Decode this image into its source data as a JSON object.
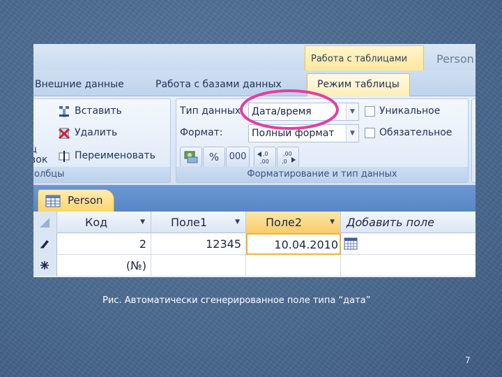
{
  "ribbon": {
    "contextual_group": "Работа с таблицами",
    "doc_title": "Person",
    "tabs": [
      {
        "label": "Внешние данные"
      },
      {
        "label": "Работа с базами данных"
      },
      {
        "label": "Режим таблицы"
      }
    ],
    "fields_group": {
      "insert": "Вставить",
      "delete": "Удалить",
      "rename": "Переименовать",
      "cut_char": "ц",
      "cut_word": "вок",
      "footer": "олбцы"
    },
    "datatype_group": {
      "type_label": "Тип данных:",
      "type_value": "Дата/время",
      "format_label": "Формат:",
      "format_value": "Полный формат",
      "unique_label": "Уникальное",
      "required_label": "Обязательное",
      "percent_btn": "%",
      "thousands_btn": "000",
      "footer": "Форматирование и тип данных"
    },
    "highlight_color": "#e040a0"
  },
  "table": {
    "doc_tab": "Person",
    "columns": [
      "Код",
      "Поле1",
      "Поле2",
      "Добавить поле"
    ],
    "rows": [
      {
        "kod": "2",
        "pole1": "12345",
        "pole2": "10.04.2010"
      },
      {
        "kod": "(№)",
        "pole1": "",
        "pole2": ""
      }
    ]
  },
  "caption": "Рис. Автоматически сгенерированное поле типа “дата”",
  "slide_number": "7"
}
